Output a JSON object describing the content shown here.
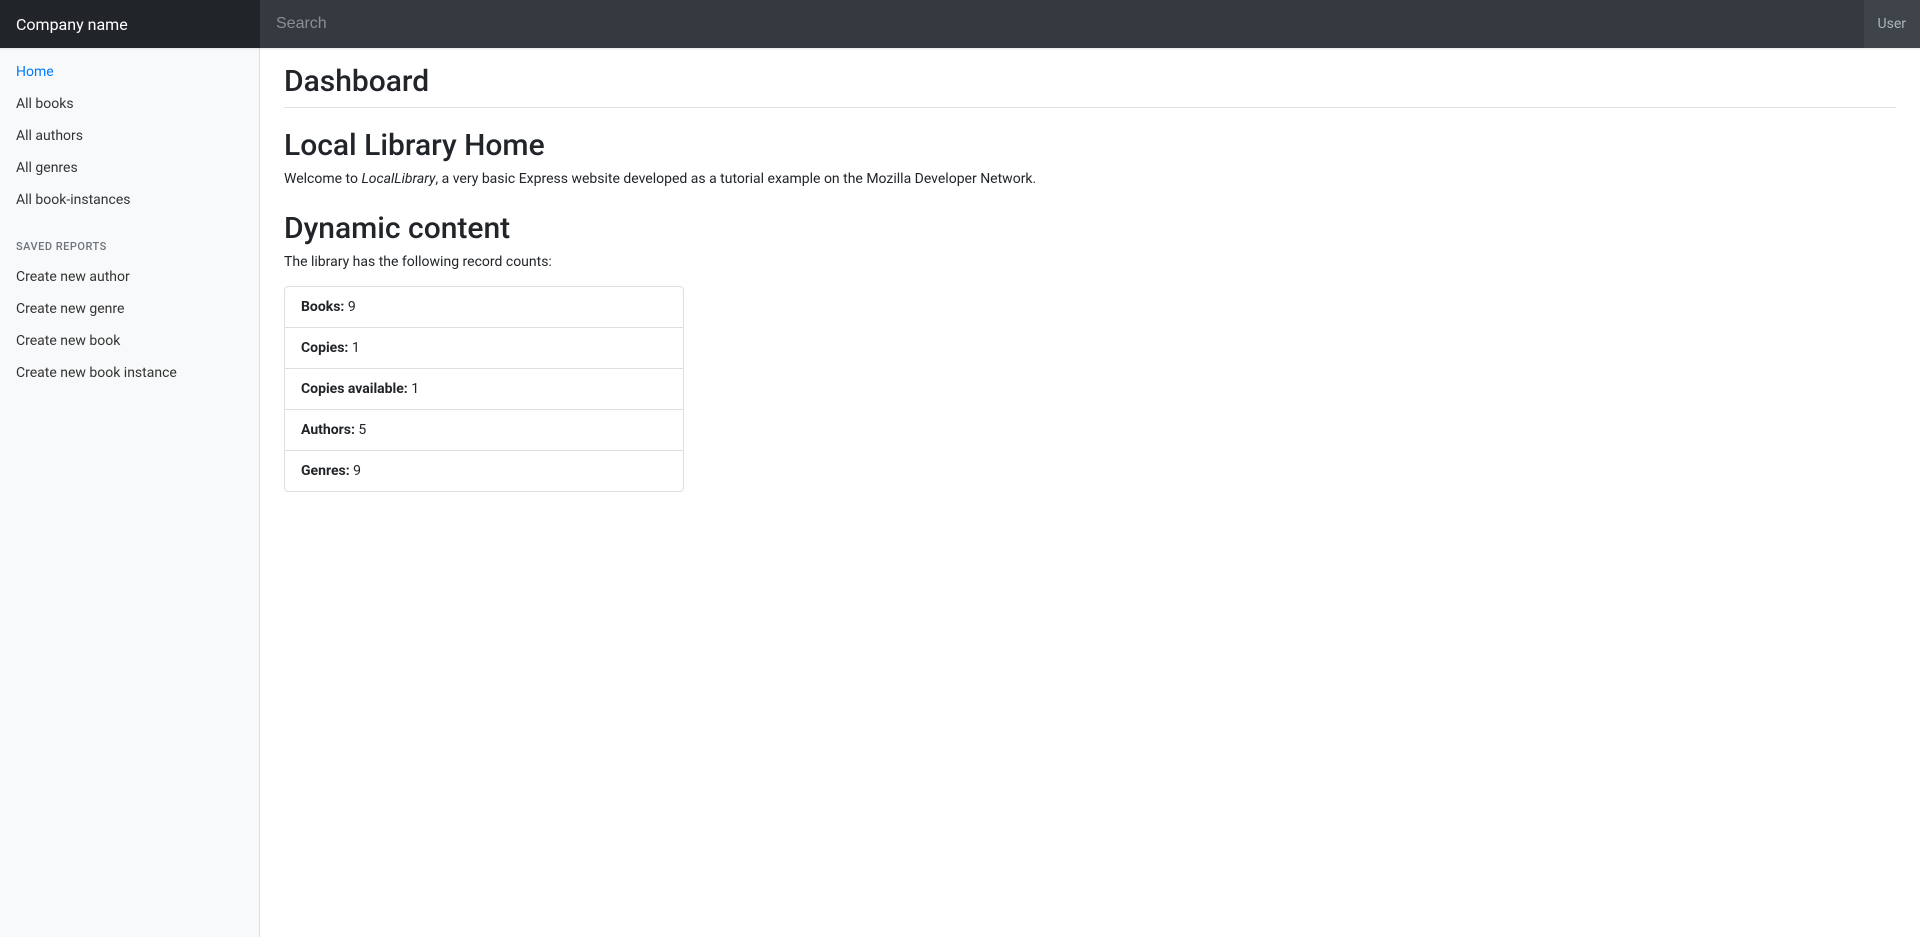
{
  "header": {
    "brand": "Company name",
    "search_placeholder": "Search",
    "user_label": "User"
  },
  "sidebar": {
    "nav": [
      {
        "label": "Home",
        "active": true
      },
      {
        "label": "All books",
        "active": false
      },
      {
        "label": "All authors",
        "active": false
      },
      {
        "label": "All genres",
        "active": false
      },
      {
        "label": "All book-instances",
        "active": false
      }
    ],
    "section_heading": "Saved reports",
    "actions": [
      {
        "label": "Create new author"
      },
      {
        "label": "Create new genre"
      },
      {
        "label": "Create new book"
      },
      {
        "label": "Create new book instance"
      }
    ]
  },
  "main": {
    "page_title": "Dashboard",
    "home_title": "Local Library Home",
    "welcome_prefix": "Welcome to ",
    "welcome_em": "LocalLibrary",
    "welcome_suffix": ", a very basic Express website developed as a tutorial example on the Mozilla Developer Network.",
    "dynamic_title": "Dynamic content",
    "records_intro": "The library has the following record counts:",
    "records": [
      {
        "label": "Books:",
        "value": "9"
      },
      {
        "label": "Copies:",
        "value": "1"
      },
      {
        "label": "Copies available:",
        "value": "1"
      },
      {
        "label": "Authors:",
        "value": "5"
      },
      {
        "label": "Genres:",
        "value": "9"
      }
    ]
  }
}
